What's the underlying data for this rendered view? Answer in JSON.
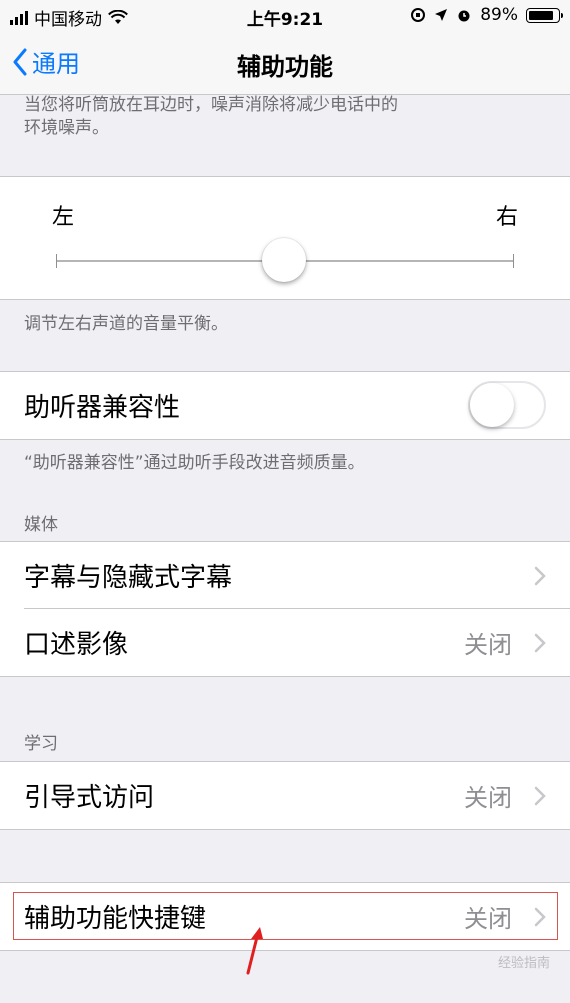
{
  "status": {
    "carrier": "中国移动",
    "time": "上午9:21",
    "battery": "89%",
    "battery_level": 0.89
  },
  "nav": {
    "back_label": "通用",
    "title": "辅助功能"
  },
  "noise_footer": {
    "line1": "当您将听筒放在耳边时，噪声消除将减少电话中的",
    "line2": "环境噪声。"
  },
  "balance": {
    "left_label": "左",
    "right_label": "右",
    "value": 0.5
  },
  "balance_footer": "调节左右声道的音量平衡。",
  "hearing_aid": {
    "label": "助听器兼容性",
    "on": false
  },
  "hearing_aid_footer": "“助听器兼容性”通过助听手段改进音频质量。",
  "media": {
    "header": "媒体",
    "items": [
      {
        "label": "字幕与隐藏式字幕",
        "value": ""
      },
      {
        "label": "口述影像",
        "value": "关闭"
      }
    ]
  },
  "learning": {
    "header": "学习",
    "items": [
      {
        "label": "引导式访问",
        "value": "关闭"
      }
    ]
  },
  "shortcut": {
    "label": "辅助功能快捷键",
    "value": "关闭"
  },
  "watermark": "经验指南"
}
